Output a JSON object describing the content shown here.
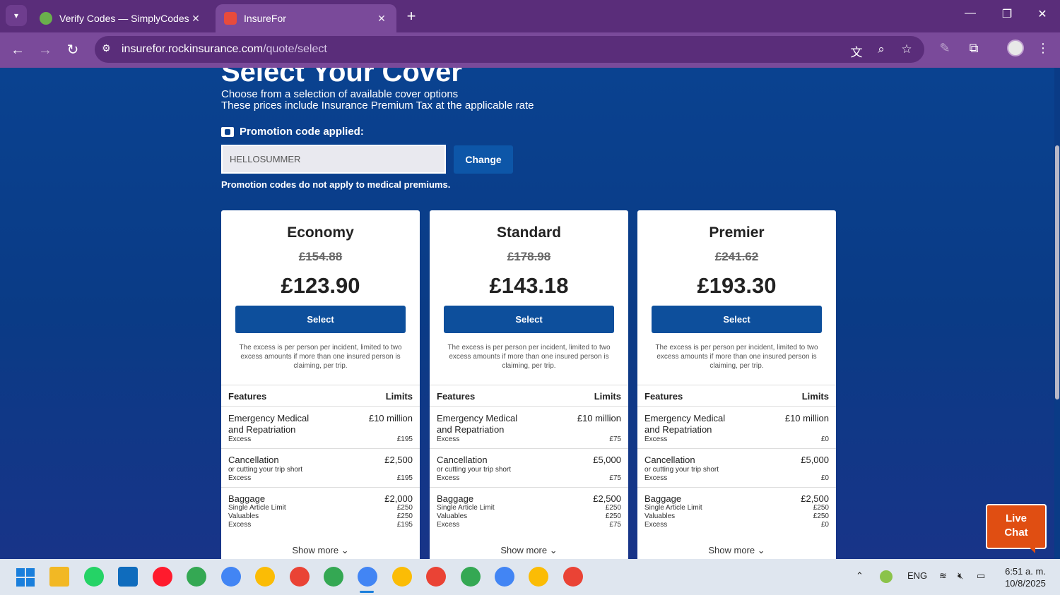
{
  "browser": {
    "tabs": [
      {
        "title": "Verify Codes — SimplyCodes",
        "close": "✕"
      },
      {
        "title": "InsureFor",
        "close": "✕"
      }
    ],
    "new_tab": "+",
    "url_domain": "insurefor.rockinsurance.com",
    "url_path": "/quote/select"
  },
  "page": {
    "title": "Select Your Cover",
    "subtitle1": "Choose from a selection of available cover options",
    "subtitle2": "These prices include Insurance Premium Tax at the applicable rate",
    "promo_label": "Promotion code applied:",
    "promo_value": "HELLOSUMMER",
    "change_label": "Change",
    "promo_note": "Promotion codes do not apply to medical premiums."
  },
  "common": {
    "select_label": "Select",
    "excess_note": "The excess is per person per incident, limited to two excess amounts if more than one insured person is claiming, per trip.",
    "features_label": "Features",
    "limits_label": "Limits",
    "emergency_label": "Emergency Medical and Repatriation",
    "excess_label": "Excess",
    "cancellation_label": "Cancellation",
    "cancellation_sub": "or cutting your trip short",
    "baggage_label": "Baggage",
    "single_article_label": "Single Article Limit",
    "valuables_label": "Valuables",
    "show_more_label": "Show more"
  },
  "plans": [
    {
      "name": "Economy",
      "old_price": "£154.88",
      "price": "£123.90",
      "emergency": "£10 million",
      "emergency_excess": "£195",
      "cancellation": "£2,500",
      "cancellation_excess": "£195",
      "baggage": "£2,000",
      "single_article": "£250",
      "valuables": "£250",
      "baggage_excess": "£195"
    },
    {
      "name": "Standard",
      "old_price": "£178.98",
      "price": "£143.18",
      "emergency": "£10 million",
      "emergency_excess": "£75",
      "cancellation": "£5,000",
      "cancellation_excess": "£75",
      "baggage": "£2,500",
      "single_article": "£250",
      "valuables": "£250",
      "baggage_excess": "£75"
    },
    {
      "name": "Premier",
      "old_price": "£241.62",
      "price": "£193.30",
      "emergency": "£10 million",
      "emergency_excess": "£0",
      "cancellation": "£5,000",
      "cancellation_excess": "£0",
      "baggage": "£2,500",
      "single_article": "£250",
      "valuables": "£250",
      "baggage_excess": "£0"
    }
  ],
  "live_chat": {
    "line1": "Live",
    "line2": "Chat"
  },
  "taskbar": {
    "lang": "ENG",
    "time": "6:51 a. m.",
    "date": "10/8/2025"
  },
  "colors": {
    "tab_bar": "#5a2d7a",
    "toolbar": "#7a4a9a",
    "page_bg": "#0a4290",
    "button": "#0d4f9c",
    "live_chat": "#e04e12"
  }
}
